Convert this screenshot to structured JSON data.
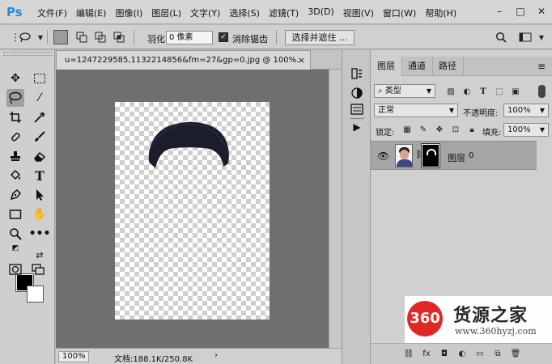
{
  "app": {
    "logo": "Ps",
    "menu": [
      "文件(F)",
      "编辑(E)",
      "图像(I)",
      "图层(L)",
      "文字(Y)",
      "选择(S)",
      "滤镜(T)",
      "3D(D)",
      "视图(V)",
      "窗口(W)",
      "帮助(H)"
    ],
    "window_controls": [
      "minimize-icon",
      "maximize-icon",
      "close-icon"
    ]
  },
  "options": {
    "feather_label": "羽化:",
    "feather_value": "0 像素",
    "antialias_label": "消除锯齿",
    "antialias_checked": true,
    "select_mask_label": "选择并遮住 ..."
  },
  "document": {
    "tab_title": "u=1247229585,1132214856&fm=27&gp=0.jpg @ 100%...",
    "close": "×",
    "zoom": "100%",
    "info": "文档:188.1K/250.8K",
    "info_arrow": "›"
  },
  "layers_panel": {
    "tabs": [
      "图层",
      "通道",
      "路径"
    ],
    "filter_kind": "类型",
    "blend_mode": "正常",
    "opacity_label": "不透明度:",
    "opacity_value": "100%",
    "lock_label": "锁定:",
    "fill_label": "填充:",
    "fill_value": "100%",
    "layer": {
      "name": "图层",
      "lock_index": "0",
      "visible": true
    }
  },
  "watermark": {
    "badge": "360",
    "title": "货源之家",
    "url": "www.360hyzj.com"
  }
}
